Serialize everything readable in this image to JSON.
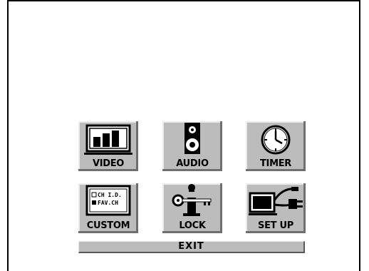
{
  "menu": {
    "items": [
      {
        "label": "VIDEO",
        "icon": "video-monitor-icon"
      },
      {
        "label": "AUDIO",
        "icon": "speaker-icon"
      },
      {
        "label": "TIMER",
        "icon": "clock-icon"
      },
      {
        "label": "CUSTOM",
        "icon": "custom-list-icon"
      },
      {
        "label": "LOCK",
        "icon": "key-icon"
      },
      {
        "label": "SET UP",
        "icon": "setup-plug-icon"
      }
    ],
    "custom_icon_lines": [
      "CH I.D.",
      "FAV.CH"
    ],
    "exit_label": "EXIT"
  },
  "colors": {
    "tile_face": "#bcbcbc",
    "tile_shadow": "#6f6f6f",
    "icon_ink": "#000000"
  }
}
